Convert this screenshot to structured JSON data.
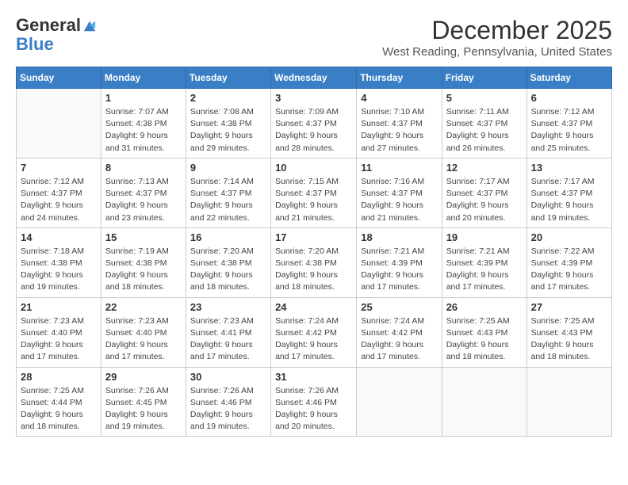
{
  "logo": {
    "general": "General",
    "blue": "Blue"
  },
  "header": {
    "month": "December 2025",
    "location": "West Reading, Pennsylvania, United States"
  },
  "days_of_week": [
    "Sunday",
    "Monday",
    "Tuesday",
    "Wednesday",
    "Thursday",
    "Friday",
    "Saturday"
  ],
  "weeks": [
    [
      {
        "day": "",
        "info": ""
      },
      {
        "day": "1",
        "info": "Sunrise: 7:07 AM\nSunset: 4:38 PM\nDaylight: 9 hours\nand 31 minutes."
      },
      {
        "day": "2",
        "info": "Sunrise: 7:08 AM\nSunset: 4:38 PM\nDaylight: 9 hours\nand 29 minutes."
      },
      {
        "day": "3",
        "info": "Sunrise: 7:09 AM\nSunset: 4:37 PM\nDaylight: 9 hours\nand 28 minutes."
      },
      {
        "day": "4",
        "info": "Sunrise: 7:10 AM\nSunset: 4:37 PM\nDaylight: 9 hours\nand 27 minutes."
      },
      {
        "day": "5",
        "info": "Sunrise: 7:11 AM\nSunset: 4:37 PM\nDaylight: 9 hours\nand 26 minutes."
      },
      {
        "day": "6",
        "info": "Sunrise: 7:12 AM\nSunset: 4:37 PM\nDaylight: 9 hours\nand 25 minutes."
      }
    ],
    [
      {
        "day": "7",
        "info": "Sunrise: 7:12 AM\nSunset: 4:37 PM\nDaylight: 9 hours\nand 24 minutes."
      },
      {
        "day": "8",
        "info": "Sunrise: 7:13 AM\nSunset: 4:37 PM\nDaylight: 9 hours\nand 23 minutes."
      },
      {
        "day": "9",
        "info": "Sunrise: 7:14 AM\nSunset: 4:37 PM\nDaylight: 9 hours\nand 22 minutes."
      },
      {
        "day": "10",
        "info": "Sunrise: 7:15 AM\nSunset: 4:37 PM\nDaylight: 9 hours\nand 21 minutes."
      },
      {
        "day": "11",
        "info": "Sunrise: 7:16 AM\nSunset: 4:37 PM\nDaylight: 9 hours\nand 21 minutes."
      },
      {
        "day": "12",
        "info": "Sunrise: 7:17 AM\nSunset: 4:37 PM\nDaylight: 9 hours\nand 20 minutes."
      },
      {
        "day": "13",
        "info": "Sunrise: 7:17 AM\nSunset: 4:37 PM\nDaylight: 9 hours\nand 19 minutes."
      }
    ],
    [
      {
        "day": "14",
        "info": "Sunrise: 7:18 AM\nSunset: 4:38 PM\nDaylight: 9 hours\nand 19 minutes."
      },
      {
        "day": "15",
        "info": "Sunrise: 7:19 AM\nSunset: 4:38 PM\nDaylight: 9 hours\nand 18 minutes."
      },
      {
        "day": "16",
        "info": "Sunrise: 7:20 AM\nSunset: 4:38 PM\nDaylight: 9 hours\nand 18 minutes."
      },
      {
        "day": "17",
        "info": "Sunrise: 7:20 AM\nSunset: 4:38 PM\nDaylight: 9 hours\nand 18 minutes."
      },
      {
        "day": "18",
        "info": "Sunrise: 7:21 AM\nSunset: 4:39 PM\nDaylight: 9 hours\nand 17 minutes."
      },
      {
        "day": "19",
        "info": "Sunrise: 7:21 AM\nSunset: 4:39 PM\nDaylight: 9 hours\nand 17 minutes."
      },
      {
        "day": "20",
        "info": "Sunrise: 7:22 AM\nSunset: 4:39 PM\nDaylight: 9 hours\nand 17 minutes."
      }
    ],
    [
      {
        "day": "21",
        "info": "Sunrise: 7:23 AM\nSunset: 4:40 PM\nDaylight: 9 hours\nand 17 minutes."
      },
      {
        "day": "22",
        "info": "Sunrise: 7:23 AM\nSunset: 4:40 PM\nDaylight: 9 hours\nand 17 minutes."
      },
      {
        "day": "23",
        "info": "Sunrise: 7:23 AM\nSunset: 4:41 PM\nDaylight: 9 hours\nand 17 minutes."
      },
      {
        "day": "24",
        "info": "Sunrise: 7:24 AM\nSunset: 4:42 PM\nDaylight: 9 hours\nand 17 minutes."
      },
      {
        "day": "25",
        "info": "Sunrise: 7:24 AM\nSunset: 4:42 PM\nDaylight: 9 hours\nand 17 minutes."
      },
      {
        "day": "26",
        "info": "Sunrise: 7:25 AM\nSunset: 4:43 PM\nDaylight: 9 hours\nand 18 minutes."
      },
      {
        "day": "27",
        "info": "Sunrise: 7:25 AM\nSunset: 4:43 PM\nDaylight: 9 hours\nand 18 minutes."
      }
    ],
    [
      {
        "day": "28",
        "info": "Sunrise: 7:25 AM\nSunset: 4:44 PM\nDaylight: 9 hours\nand 18 minutes."
      },
      {
        "day": "29",
        "info": "Sunrise: 7:26 AM\nSunset: 4:45 PM\nDaylight: 9 hours\nand 19 minutes."
      },
      {
        "day": "30",
        "info": "Sunrise: 7:26 AM\nSunset: 4:46 PM\nDaylight: 9 hours\nand 19 minutes."
      },
      {
        "day": "31",
        "info": "Sunrise: 7:26 AM\nSunset: 4:46 PM\nDaylight: 9 hours\nand 20 minutes."
      },
      {
        "day": "",
        "info": ""
      },
      {
        "day": "",
        "info": ""
      },
      {
        "day": "",
        "info": ""
      }
    ]
  ]
}
